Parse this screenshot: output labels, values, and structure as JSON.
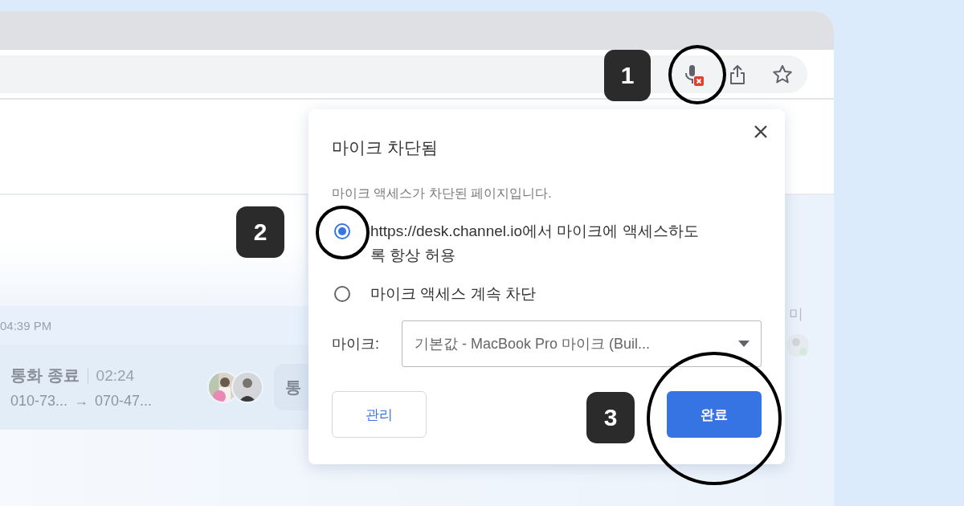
{
  "background_page": {
    "time": "04:39 PM",
    "call": {
      "status": "통화 종료",
      "duration": "02:24",
      "from": "010-73...",
      "arrow": "→",
      "to": "070-47...",
      "button_label": "통"
    },
    "side_text": "미"
  },
  "popup": {
    "title": "마이크 차단됨",
    "description": "마이크 액세스가 차단된 페이지입니다.",
    "options": [
      {
        "label": "https://desk.channel.io에서 마이크에 액세스하도록 항상 허용",
        "selected": true
      },
      {
        "label": "마이크 액세스 계속 차단",
        "selected": false
      }
    ],
    "mic_label": "마이크:",
    "mic_value": "기본값 - MacBook Pro 마이크 (Buil...",
    "buttons": [
      {
        "label": "관리",
        "kind": "secondary"
      },
      {
        "label": "완료",
        "kind": "primary"
      }
    ]
  },
  "callouts": [
    "1",
    "2",
    "3"
  ]
}
